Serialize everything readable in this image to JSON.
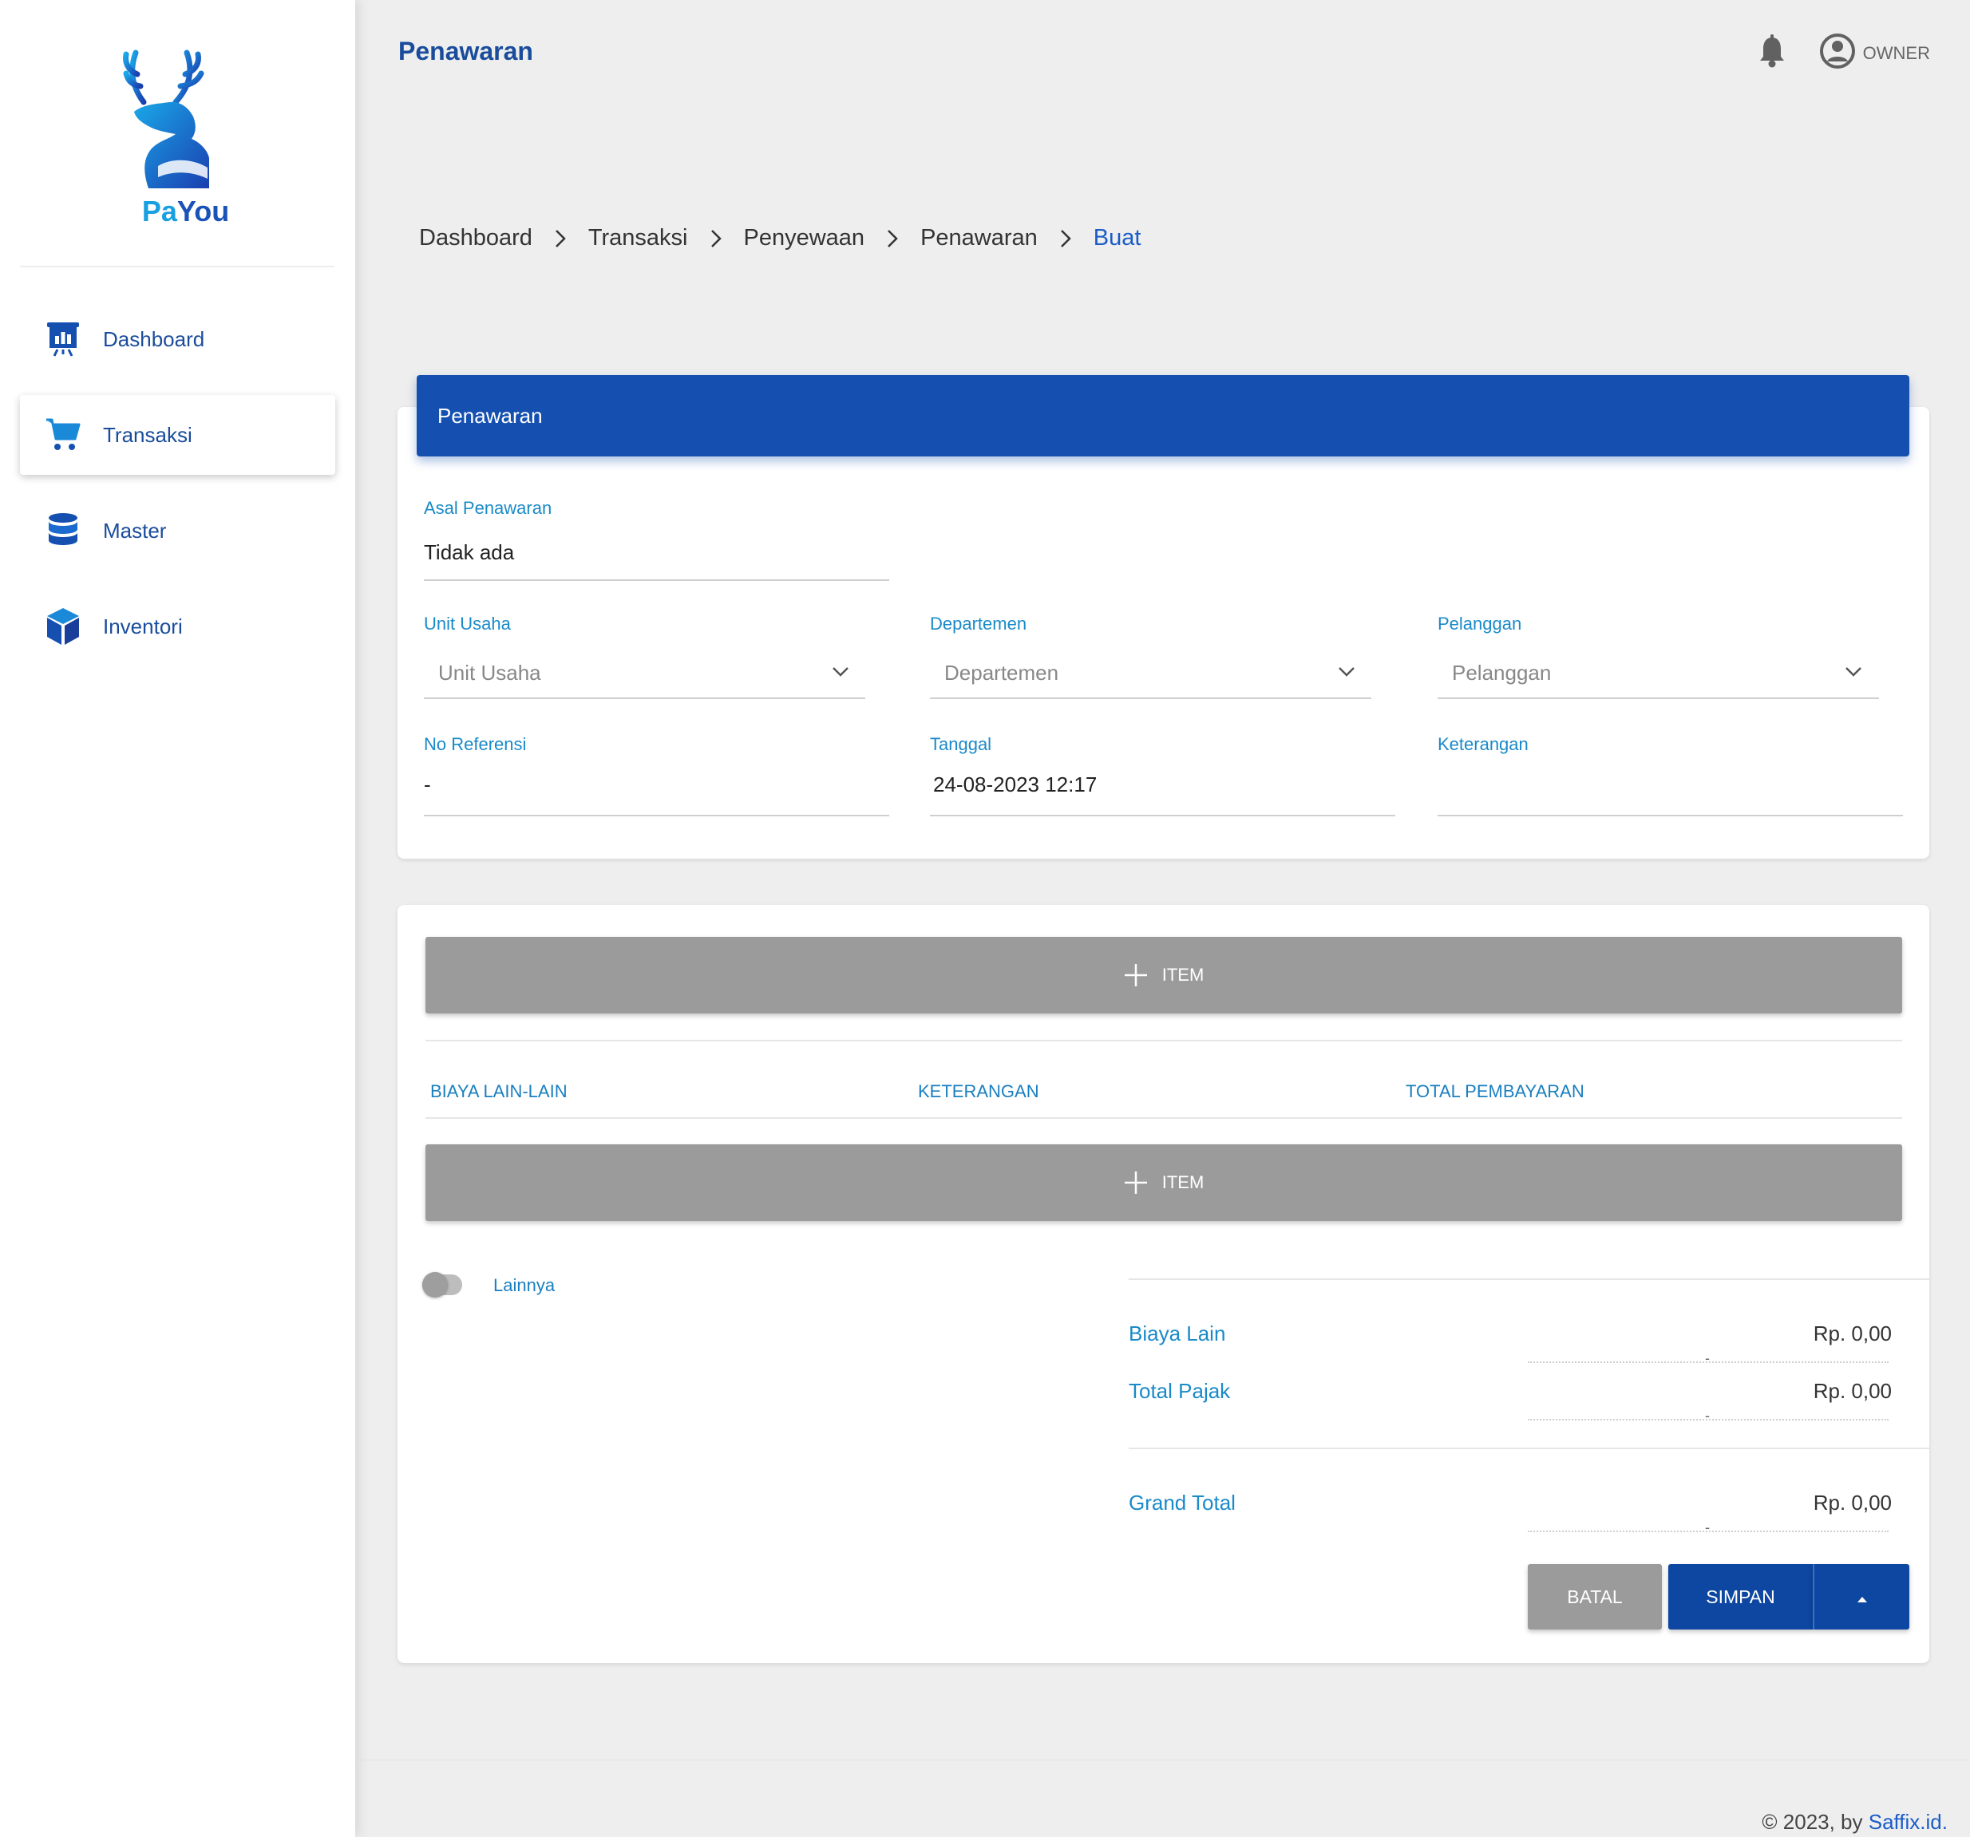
{
  "brand": {
    "name_part1": "Pa",
    "name_part2": "You"
  },
  "sidebar": {
    "items": [
      {
        "label": "Dashboard",
        "icon": "dashboard-chart-icon"
      },
      {
        "label": "Transaksi",
        "icon": "cart-icon",
        "active": true
      },
      {
        "label": "Master",
        "icon": "database-icon"
      },
      {
        "label": "Inventori",
        "icon": "box-icon"
      }
    ]
  },
  "header": {
    "title": "Penawaran",
    "user_label": "OWNER"
  },
  "breadcrumb": [
    "Dashboard",
    "Transaksi",
    "Penyewaan",
    "Penawaran",
    "Buat"
  ],
  "form": {
    "card_title": "Penawaran",
    "asal_label": "Asal Penawaran",
    "asal_value": "Tidak ada",
    "unit_label": "Unit Usaha",
    "unit_placeholder": "Unit Usaha",
    "dept_label": "Departemen",
    "dept_placeholder": "Departemen",
    "pelanggan_label": "Pelanggan",
    "pelanggan_placeholder": "Pelanggan",
    "noref_label": "No Referensi",
    "noref_value": "-",
    "tanggal_label": "Tanggal",
    "tanggal_value": "24-08-2023 12:17",
    "keterangan_label": "Keterangan",
    "keterangan_value": ""
  },
  "items": {
    "add_item_label": "ITEM",
    "add_biaya_label": "ITEM",
    "columns": [
      "BIAYA LAIN-LAIN",
      "KETERANGAN",
      "TOTAL PEMBAYARAN"
    ],
    "toggle_label": "Lainnya"
  },
  "summary": {
    "biaya_lain_label": "Biaya Lain",
    "biaya_lain_value": "Rp. 0,00",
    "total_pajak_label": "Total Pajak",
    "total_pajak_value": "Rp. 0,00",
    "grand_total_label": "Grand Total",
    "grand_total_value": "Rp. 0,00",
    "dash": "-"
  },
  "actions": {
    "cancel_label": "BATAL",
    "save_label": "SIMPAN"
  },
  "footer": {
    "prefix": "© 2023, by ",
    "link": "Saffix.id."
  },
  "colors": {
    "primary": "#1550b1",
    "accent_text": "#1a8ac8",
    "button_gray": "#9b9b9b"
  }
}
